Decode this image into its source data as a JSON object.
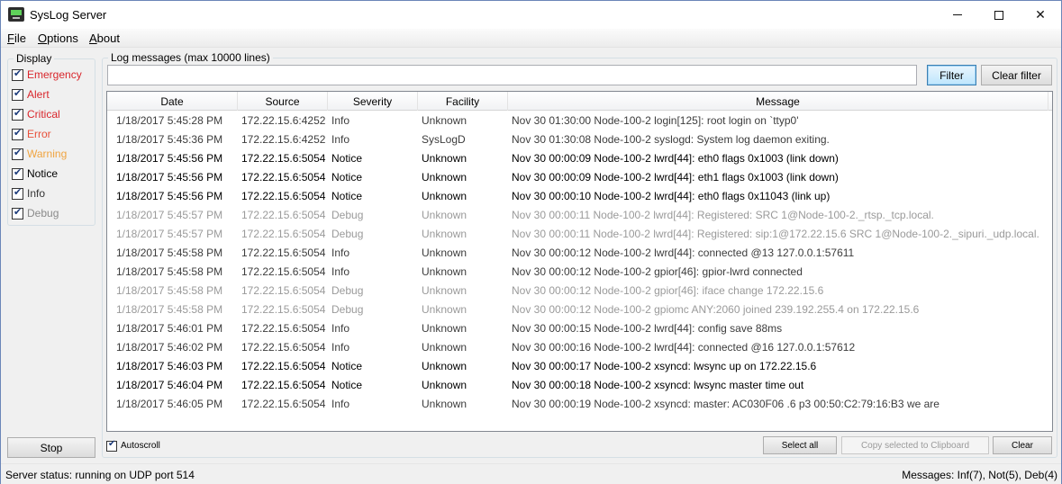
{
  "window": {
    "title": "SysLog Server",
    "app_icon": "terminal-icon",
    "controls": {
      "minimize": "minimize-icon",
      "maximize": "maximize-icon",
      "close": "close-icon"
    }
  },
  "menu": {
    "items": [
      {
        "accel": "F",
        "rest": "ile"
      },
      {
        "accel": "O",
        "rest": "ptions"
      },
      {
        "accel": "A",
        "rest": "bout"
      }
    ]
  },
  "display": {
    "legend": "Display",
    "options": [
      {
        "label": "Emergency",
        "checked": true,
        "color": "#d9262c"
      },
      {
        "label": "Alert",
        "checked": true,
        "color": "#d9262c"
      },
      {
        "label": "Critical",
        "checked": true,
        "color": "#d9262c"
      },
      {
        "label": "Error",
        "checked": true,
        "color": "#e8503a"
      },
      {
        "label": "Warning",
        "checked": true,
        "color": "#f0a440"
      },
      {
        "label": "Notice",
        "checked": true,
        "color": "#000000"
      },
      {
        "label": "Info",
        "checked": true,
        "color": "#333333"
      },
      {
        "label": "Debug",
        "checked": true,
        "color": "#8a8a8a"
      }
    ],
    "stop_label": "Stop"
  },
  "log": {
    "legend": "Log messages (max 10000 lines)",
    "filter_value": "",
    "filter_label": "Filter",
    "clear_filter_label": "Clear filter",
    "columns": [
      "Date",
      "Source",
      "Severity",
      "Facility",
      "Message"
    ],
    "severity_colors": {
      "Info": "#3c3c3c",
      "Notice": "#000000",
      "Debug": "#9a9a9a"
    },
    "rows": [
      [
        "1/18/2017 5:45:28 PM",
        "172.22.15.6:4252",
        "Info",
        "Unknown",
        "Nov 30 01:30:00 Node-100-2 login[125]: root login  on `ttyp0'"
      ],
      [
        "1/18/2017 5:45:36 PM",
        "172.22.15.6:4252",
        "Info",
        "SysLogD",
        "Nov 30 01:30:08 Node-100-2 syslogd: System log daemon exiting."
      ],
      [
        "1/18/2017 5:45:56 PM",
        "172.22.15.6:5054",
        "Notice",
        "Unknown",
        "Nov 30 00:00:09 Node-100-2 lwrd[44]: eth0 flags 0x1003 (link down)"
      ],
      [
        "1/18/2017 5:45:56 PM",
        "172.22.15.6:5054",
        "Notice",
        "Unknown",
        "Nov 30 00:00:09 Node-100-2 lwrd[44]: eth1 flags 0x1003 (link down)"
      ],
      [
        "1/18/2017 5:45:56 PM",
        "172.22.15.6:5054",
        "Notice",
        "Unknown",
        "Nov 30 00:00:10 Node-100-2 lwrd[44]: eth0 flags 0x11043 (link up)"
      ],
      [
        "1/18/2017 5:45:57 PM",
        "172.22.15.6:5054",
        "Debug",
        "Unknown",
        "Nov 30 00:00:11 Node-100-2 lwrd[44]: Registered: SRC 1@Node-100-2._rtsp._tcp.local."
      ],
      [
        "1/18/2017 5:45:57 PM",
        "172.22.15.6:5054",
        "Debug",
        "Unknown",
        "Nov 30 00:00:11 Node-100-2 lwrd[44]: Registered: sip:1@172.22.15.6 SRC 1@Node-100-2._sipuri._udp.local."
      ],
      [
        "1/18/2017 5:45:58 PM",
        "172.22.15.6:5054",
        "Info",
        "Unknown",
        "Nov 30 00:00:12 Node-100-2 lwrd[44]: connected @13 127.0.0.1:57611"
      ],
      [
        "1/18/2017 5:45:58 PM",
        "172.22.15.6:5054",
        "Info",
        "Unknown",
        "Nov 30 00:00:12 Node-100-2 gpior[46]: gpior-lwrd connected"
      ],
      [
        "1/18/2017 5:45:58 PM",
        "172.22.15.6:5054",
        "Debug",
        "Unknown",
        "Nov 30 00:00:12 Node-100-2 gpior[46]: iface change 172.22.15.6"
      ],
      [
        "1/18/2017 5:45:58 PM",
        "172.22.15.6:5054",
        "Debug",
        "Unknown",
        "Nov 30 00:00:12 Node-100-2 gpiomc ANY:2060 joined 239.192.255.4 on 172.22.15.6"
      ],
      [
        "1/18/2017 5:46:01 PM",
        "172.22.15.6:5054",
        "Info",
        "Unknown",
        "Nov 30 00:00:15 Node-100-2 lwrd[44]: config save 88ms"
      ],
      [
        "1/18/2017 5:46:02 PM",
        "172.22.15.6:5054",
        "Info",
        "Unknown",
        "Nov 30 00:00:16 Node-100-2 lwrd[44]: connected @16 127.0.0.1:57612"
      ],
      [
        "1/18/2017 5:46:03 PM",
        "172.22.15.6:5054",
        "Notice",
        "Unknown",
        "Nov 30 00:00:17 Node-100-2 xsyncd: lwsync up on 172.22.15.6"
      ],
      [
        "1/18/2017 5:46:04 PM",
        "172.22.15.6:5054",
        "Notice",
        "Unknown",
        "Nov 30 00:00:18 Node-100-2 xsyncd: lwsync master time out"
      ],
      [
        "1/18/2017 5:46:05 PM",
        "172.22.15.6:5054",
        "Info",
        "Unknown",
        "Nov 30 00:00:19 Node-100-2 xsyncd: master: AC030F06 .6 p3 00:50:C2:79:16:B3 we are"
      ]
    ],
    "autoscroll_label": "Autoscroll",
    "autoscroll_checked": true,
    "select_all_label": "Select all",
    "copy_label": "Copy selected to Clipboard",
    "clear_label": "Clear"
  },
  "status": {
    "left": "Server status: running on UDP port 514",
    "right": "Messages: Inf(7), Not(5), Deb(4)"
  }
}
